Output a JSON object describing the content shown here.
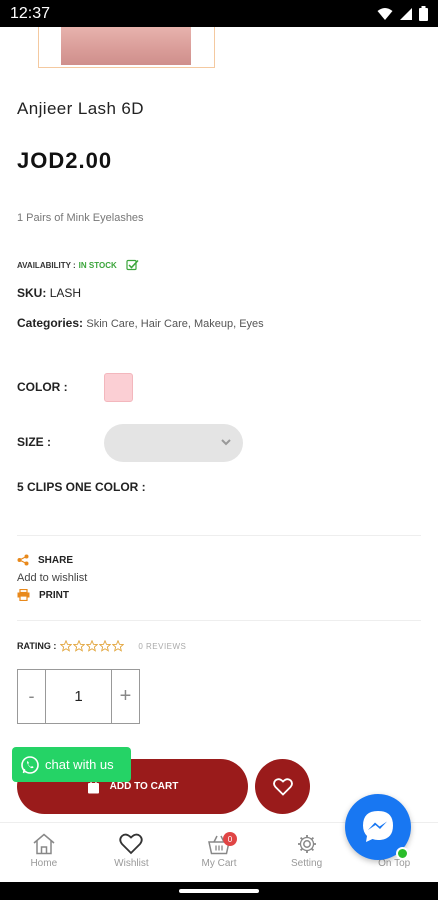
{
  "status_bar": {
    "time": "12:37"
  },
  "product": {
    "title": "Anjieer Lash 6D",
    "price": "JOD2.00",
    "description": "1 Pairs of Mink Eyelashes",
    "availability_label": "AVAILABILITY :",
    "availability_value": "IN STOCK",
    "sku_label": "SKU:",
    "sku_value": "LASH",
    "categories_label": "Categories:",
    "categories_value": "Skin Care, Hair Care, Makeup, Eyes"
  },
  "options": {
    "color_label": "COLOR :",
    "color_value": "#fbcfd4",
    "size_label": "SIZE :",
    "clips_label": "5 CLIPS ONE COLOR :"
  },
  "actions": {
    "share": "SHARE",
    "add_to_wishlist": "Add to wishlist",
    "print": "PRINT"
  },
  "rating": {
    "label": "RATING :",
    "reviews": "0 REVIEWS",
    "stars": 0,
    "max_stars": 5
  },
  "quantity": {
    "minus": "-",
    "value": "1",
    "plus": "+"
  },
  "buttons": {
    "add_to_cart": "ADD TO CART"
  },
  "chat": {
    "label": "chat with us"
  },
  "nav": {
    "items": [
      {
        "label": "Home",
        "icon": "home-icon"
      },
      {
        "label": "Wishlist",
        "icon": "heart-icon"
      },
      {
        "label": "My Cart",
        "icon": "basket-icon",
        "badge": "0"
      },
      {
        "label": "Setting",
        "icon": "gear-icon"
      },
      {
        "label": "On Top",
        "icon": "arrow-up-icon"
      }
    ]
  },
  "colors": {
    "accent": "#9a1b1b",
    "whatsapp": "#25d366",
    "messenger": "#1877f2",
    "in_stock": "#3aa53a"
  }
}
